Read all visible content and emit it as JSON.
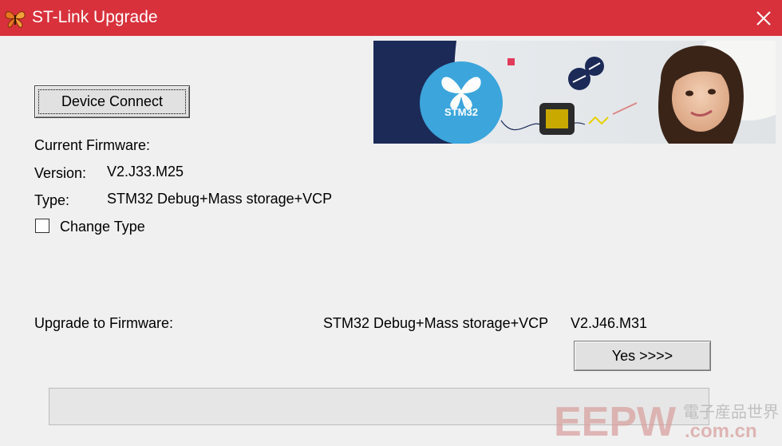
{
  "window": {
    "title": "ST-Link Upgrade",
    "titlebar_color": "#d8313c"
  },
  "buttons": {
    "device_connect": "Device Connect",
    "yes": "Yes >>>>"
  },
  "banner": {
    "logo_text": "STM32"
  },
  "firmware": {
    "heading": "Current Firmware:",
    "version_label": "Version:",
    "version_value": "V2.J33.M25",
    "type_label": "Type:",
    "type_value": "STM32 Debug+Mass storage+VCP"
  },
  "change_type": {
    "label": "Change Type",
    "checked": false
  },
  "upgrade": {
    "label": "Upgrade to Firmware:",
    "type_value": "STM32 Debug+Mass storage+VCP",
    "version_value": "V2.J46.M31"
  },
  "progress": {
    "fraction": 0
  },
  "watermark": {
    "brand": "EEPW",
    "chinese": "電子産品世界",
    "domain": ".com.cn"
  }
}
